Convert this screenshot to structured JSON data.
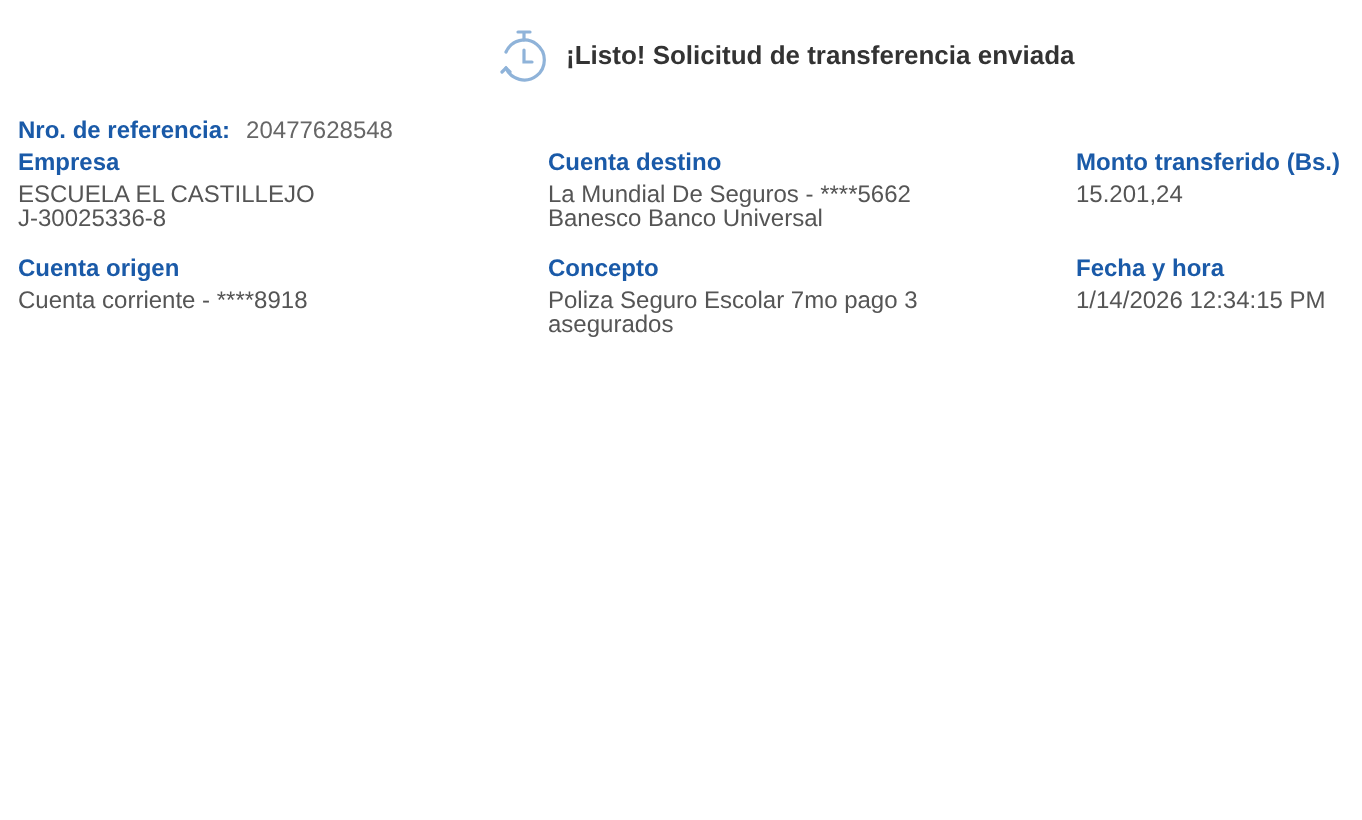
{
  "title": "¡Listo! Solicitud de transferencia enviada",
  "reference": {
    "label": "Nro. de referencia:",
    "value": "20477628548"
  },
  "fields": [
    {
      "label": "Empresa",
      "lines": [
        "ESCUELA EL CASTILLEJO",
        "J-30025336-8"
      ]
    },
    {
      "label": "Cuenta destino",
      "lines": [
        "La Mundial De Seguros - ****5662",
        "Banesco Banco Universal"
      ]
    },
    {
      "label": "Monto transferido (Bs.)",
      "lines": [
        "15.201,24"
      ]
    },
    {
      "label": "Cuenta origen",
      "lines": [
        "Cuenta corriente - ****8918"
      ]
    },
    {
      "label": "Concepto",
      "lines": [
        "Poliza Seguro Escolar 7mo pago 3",
        "asegurados"
      ]
    },
    {
      "label": "Fecha y hora",
      "lines": [
        "1/14/2026 12:34:15 PM"
      ]
    }
  ]
}
